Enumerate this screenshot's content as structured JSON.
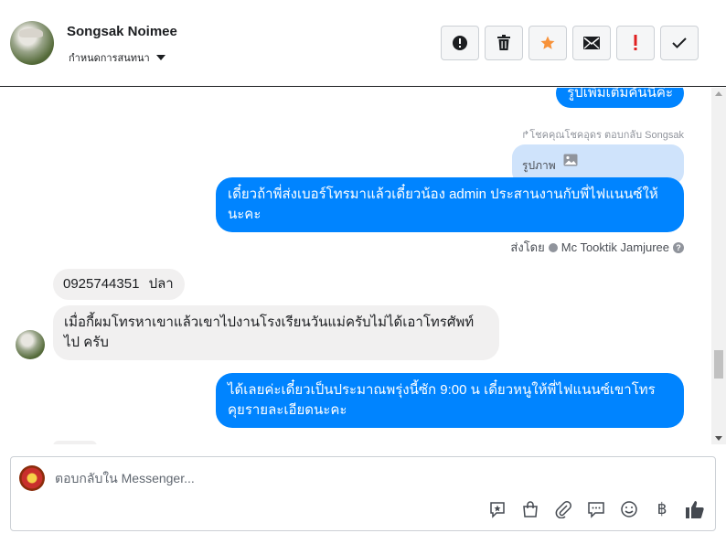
{
  "header": {
    "name": "Songsak Noimee",
    "conversation_action": "กำหนดการสนทนา"
  },
  "toolbar": {
    "buttons": [
      {
        "icon": "alert-circle-icon",
        "color": "#1c1e21"
      },
      {
        "icon": "trash-icon",
        "color": "#1c1e21"
      },
      {
        "icon": "star-icon",
        "color": "#f7923a"
      },
      {
        "icon": "envelope-icon",
        "color": "#1c1e21"
      },
      {
        "icon": "exclamation-icon",
        "color": "#e02020"
      },
      {
        "icon": "check-icon",
        "color": "#1c1e21"
      }
    ]
  },
  "thread": {
    "msg_top": "รูปเพิ่มเติมคันนี้ค่ะ",
    "reply_note": "โชคคุณโชคอุดร ตอบกลับ Songsak",
    "quoted_label": "รูปภาพ",
    "msg_agent_1": "เดี๋ยวถ้าพี่ส่งเบอร์โทรมาแล้วเดี๋ยวน้อง admin ประสานงานกับพี่ไฟแนนซ์ให้นะคะ",
    "sent_by_label": "ส่งโดย",
    "sent_by_agent": "Mc Tooktik Jamjuree",
    "msg_customer_1": "0925744351 ปลา",
    "msg_customer_2": "เมื่อกี้ผมโทรหาเขาแล้วเขาไปงานโรงเรียนวันแม่ครับไม่ได้เอาโทรศัพท์ ไป ครับ",
    "msg_agent_2": "ได้เลยค่ะเดี๋ยวเป็นประมาณพรุ่งนี้ซัก 9:00 น เดี๋ยวหนูให้พี่ไฟแนนซ์เขาโทรคุยรายละเอียดนะคะ"
  },
  "composer": {
    "placeholder": "ตอบกลับใน Messenger...",
    "icons": [
      "saved-reply-icon",
      "shopping-bag-icon",
      "paperclip-icon",
      "chat-bubbles-icon",
      "smiley-icon",
      "baht-icon",
      "like-icon"
    ],
    "accent": "#0084ff"
  }
}
